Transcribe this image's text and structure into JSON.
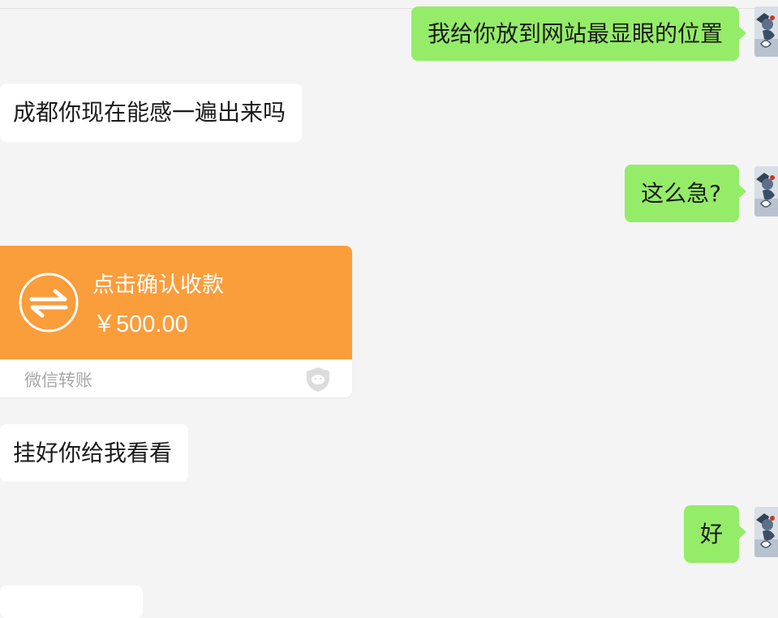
{
  "messages": [
    {
      "side": "right",
      "text": "我给你放到网站最显眼的位置"
    },
    {
      "side": "left",
      "text": "成都你现在能感一遍出来吗"
    },
    {
      "side": "right",
      "text": "这么急?"
    },
    {
      "side": "left",
      "type": "transfer"
    },
    {
      "side": "left",
      "text": "挂好你给我看看"
    },
    {
      "side": "right",
      "text": "好"
    }
  ],
  "transfer": {
    "title": "点击确认收款",
    "amount": "￥500.00",
    "label": "微信转账",
    "icon": "transfer-arrows-icon",
    "badge_icon": "wechat-shield-icon"
  },
  "colors": {
    "background": "#f4f4f4",
    "incoming_bubble": "#ffffff",
    "outgoing_bubble": "#95ec69",
    "transfer_card": "#fa9d3b"
  }
}
